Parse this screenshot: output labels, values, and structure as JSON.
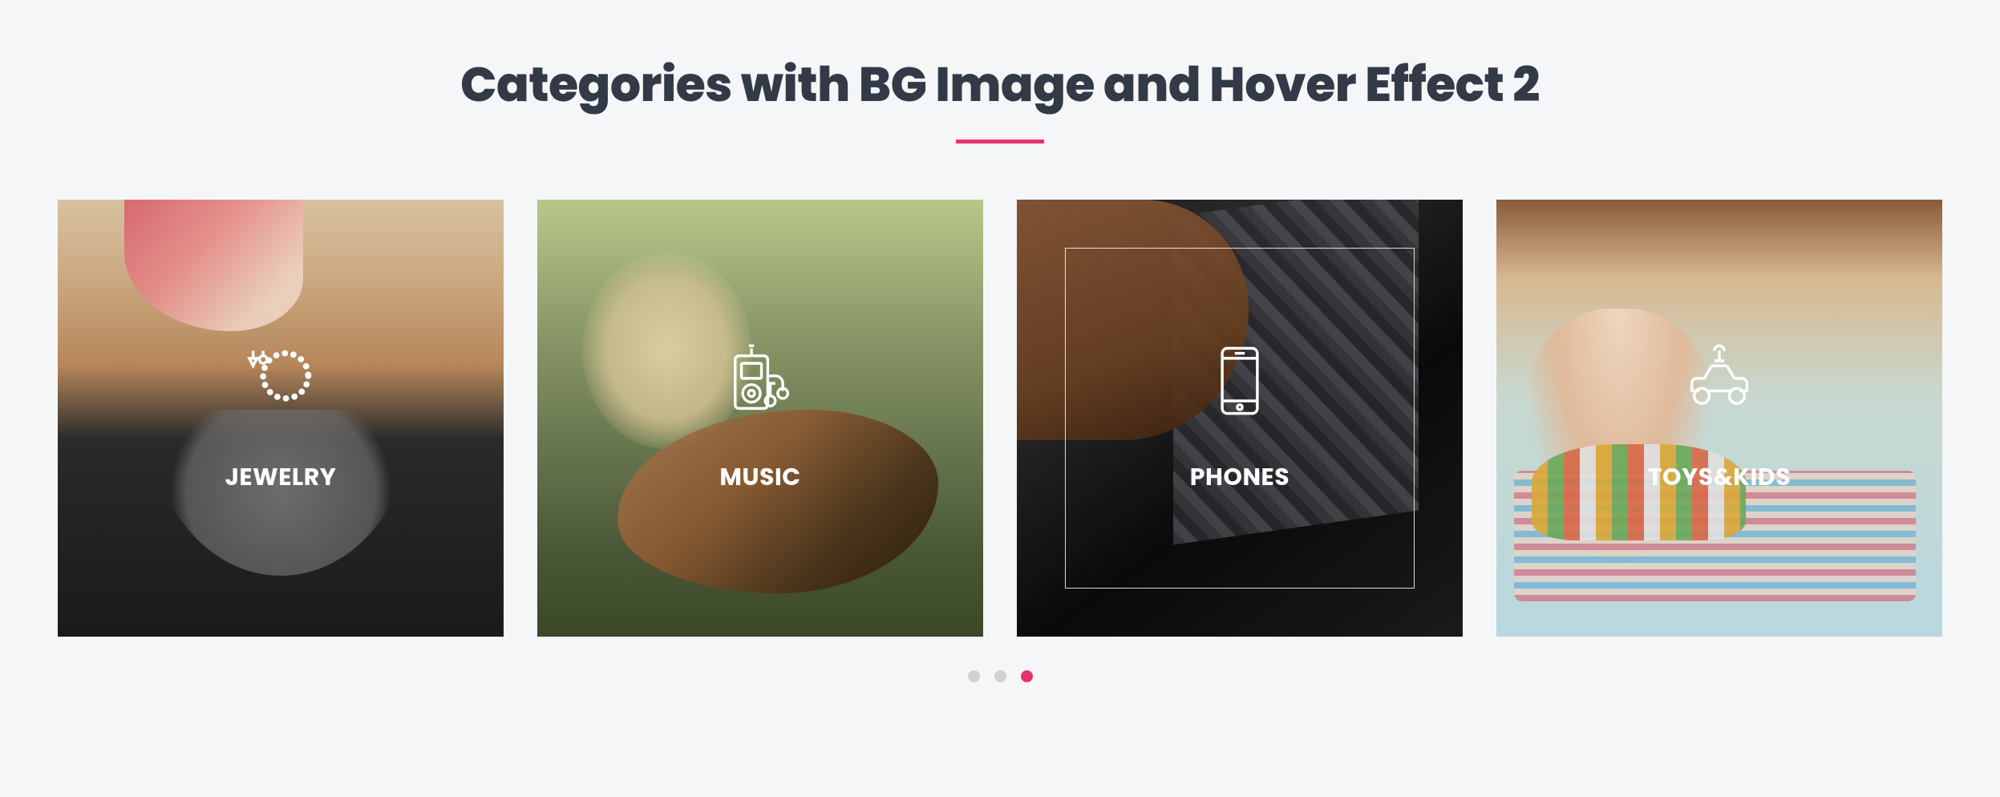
{
  "section": {
    "title": "Categories with BG Image and Hover Effect 2"
  },
  "nav": {
    "prev_icon": "chevron-left",
    "next_icon": "chevron-right"
  },
  "cards": [
    {
      "label": "JEWELRY",
      "icon": "necklace-icon"
    },
    {
      "label": "MUSIC",
      "icon": "mp3-player-icon"
    },
    {
      "label": "PHONES",
      "icon": "smartphone-icon"
    },
    {
      "label": "TOYS&KIDS",
      "icon": "toy-car-icon"
    }
  ],
  "hovered_index": 2,
  "pagination": {
    "count": 3,
    "active_index": 2
  },
  "colors": {
    "accent": "#e8326e",
    "accent_disabled": "#f3a2bc",
    "heading": "#333a47",
    "page_bg": "#f5f6f7"
  }
}
